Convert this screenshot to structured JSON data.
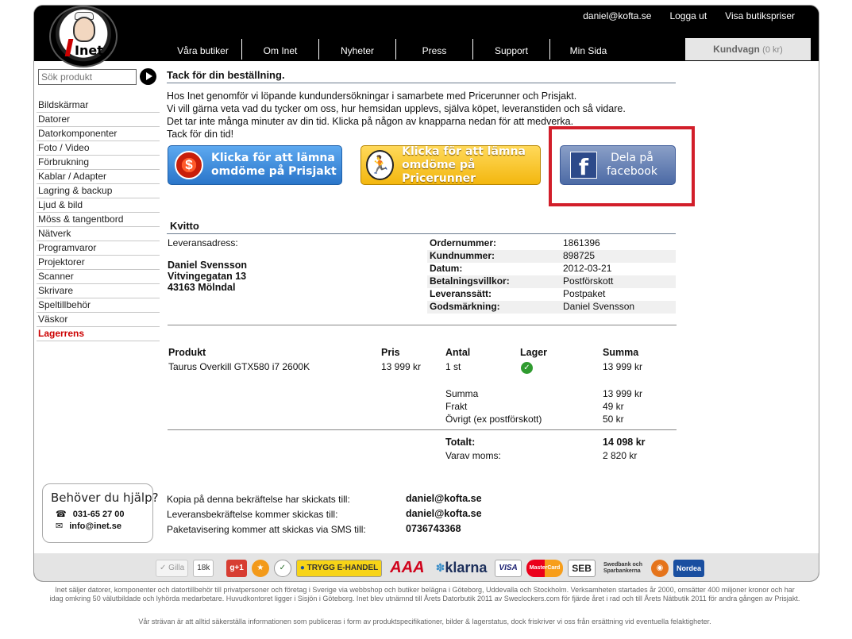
{
  "header": {
    "top_links": [
      "daniel@kofta.se",
      "Logga ut",
      "Visa butikspriser"
    ],
    "nav": [
      "Våra butiker",
      "Om Inet",
      "Nyheter",
      "Press",
      "Support",
      "Min Sida"
    ],
    "cart_label": "Kundvagn",
    "cart_amount": "(0 kr)",
    "logo_text": "Inet"
  },
  "sidebar": {
    "search_placeholder": "Sök produkt",
    "categories": [
      "Bildskärmar",
      "Datorer",
      "Datorkomponenter",
      "Foto / Video",
      "Förbrukning",
      "Kablar / Adapter",
      "Lagring & backup",
      "Ljud & bild",
      "Möss & tangentbord",
      "Nätverk",
      "Programvaror",
      "Projektorer",
      "Scanner",
      "Skrivare",
      "Speltillbehör",
      "Väskor",
      "Lagerrens"
    ],
    "help_title": "Behöver du hjälp?",
    "help_phone": "031-65 27 00",
    "help_email": "info@inet.se"
  },
  "thanks": {
    "title": "Tack för din beställning.",
    "lines": [
      "Hos Inet genomför vi löpande kundundersökningar i samarbete med Pricerunner och Prisjakt.",
      "Vi vill gärna veta vad du tycker om oss, hur hemsidan upplevs, själva köpet, leveranstiden och så vidare.",
      "Det tar inte många minuter av din tid. Klicka på någon av knapparna nedan för att medverka.",
      "Tack för din tid!"
    ],
    "btn_prisjakt": [
      "Klicka för att lämna",
      "omdöme på Prisjakt"
    ],
    "btn_pricerunner": [
      "Klicka för att lämna",
      "omdöme på Pricerunner"
    ],
    "btn_facebook": [
      "Dela på",
      "facebook"
    ],
    "highlight_color": "#d21e2a"
  },
  "receipt": {
    "title": "Kvitto",
    "address_label": "Leveransadress:",
    "address_lines": [
      "Daniel Svensson",
      "Vitvingegatan 13",
      "43163 Mölndal"
    ],
    "fields": [
      {
        "k": "Ordernummer:",
        "v": "1861396"
      },
      {
        "k": "Kundnummer:",
        "v": "898725"
      },
      {
        "k": "Datum:",
        "v": "2012-03-21"
      },
      {
        "k": "Betalningsvillkor:",
        "v": "Postförskott"
      },
      {
        "k": "Leveranssätt:",
        "v": "Postpaket"
      },
      {
        "k": "Godsmärkning:",
        "v": "Daniel Svensson"
      }
    ],
    "columns": [
      "Produkt",
      "Pris",
      "Antal",
      "Lager",
      "Summa"
    ],
    "item": {
      "product": "Taurus Overkill GTX580 i7 2600K",
      "price": "13 999 kr",
      "qty": "1 st",
      "sum": "13 999 kr"
    },
    "subtotals": [
      {
        "k": "Summa",
        "v": "13 999 kr"
      },
      {
        "k": "Frakt",
        "v": "49 kr"
      },
      {
        "k": "Övrigt (ex postförskott)",
        "v": "50 kr"
      }
    ],
    "total_label": "Totalt:",
    "total_value": "14 098 kr",
    "vat_label": "Varav moms:",
    "vat_value": "2 820 kr"
  },
  "confirm": [
    {
      "k": "Kopia på denna bekräftelse har skickats till:",
      "v": "daniel@kofta.se"
    },
    {
      "k": "Leveransbekräftelse kommer skickas till:",
      "v": "daniel@kofta.se"
    },
    {
      "k": "Paketavisering kommer att skickas via SMS till:",
      "v": "0736743368"
    }
  ],
  "footer": {
    "like_label": "Gilla",
    "like_count": "18k",
    "gplus": "g+1",
    "trygg": "TRYGG E-HANDEL",
    "aaa": "AAA",
    "klarna": "klarna",
    "visa": "VISA",
    "mastercard": "MasterCard",
    "seb": "SEB",
    "swedbank": "Swedbank och Sparbankerna",
    "nordea": "Nordea",
    "disclaimer1": "Inet säljer datorer, komponenter och datortillbehör till privatpersoner och företag i Sverige via webbshop och butiker belägna i Göteborg, Uddevalla och Stockholm. Verksamheten startades år 2000, omsätter 400 miljoner kronor och har idag omkring 50 välutbildade och lyhörda medarbetare. Huvudkontoret ligger i Sisjön i Göteborg. Inet blev utnämnd till Årets Datorbutik 2011 av Sweclockers.com för fjärde året i rad och till Årets Nätbutik 2011 för andra gången av Prisjakt.",
    "disclaimer2": "Vår strävan är att alltid säkerställa informationen som publiceras i form av produktspecifikationer, bilder & lagerstatus, dock friskriver vi oss från ersättning vid eventuella felaktigheter."
  }
}
